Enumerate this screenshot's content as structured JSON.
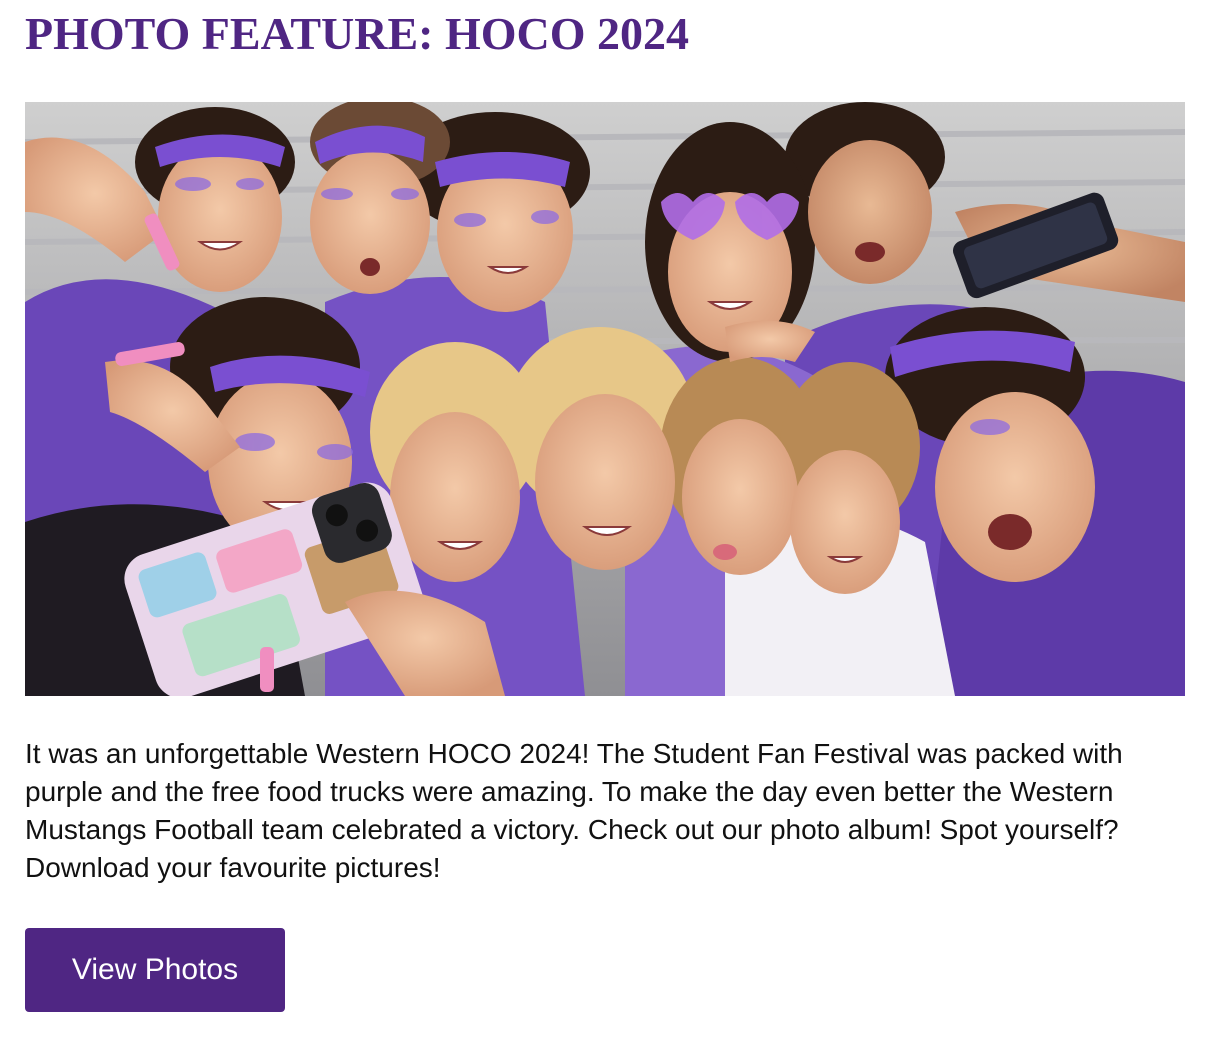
{
  "feature": {
    "title": "PHOTO FEATURE: HOCO 2024",
    "body": "It was an unforgettable Western HOCO 2024! The Student Fan Festival was packed with purple and the free food trucks were amazing. To make the day even better the Western Mustangs Football team celebrated a victory. Check out our photo album! Spot yourself? Download your favourite pictures!",
    "button_label": "View Photos"
  },
  "colors": {
    "brand_purple": "#4f2683",
    "text": "#111111",
    "button_text": "#ffffff"
  }
}
